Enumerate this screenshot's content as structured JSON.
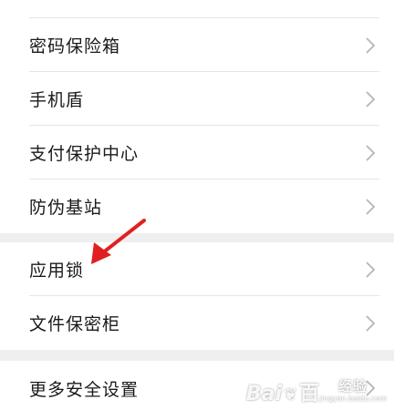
{
  "settings": {
    "items": [
      {
        "label": "密码保险箱"
      },
      {
        "label": "手机盾"
      },
      {
        "label": "支付保护中心"
      },
      {
        "label": "防伪基站"
      },
      {
        "label": "应用锁"
      },
      {
        "label": "文件保密柜"
      },
      {
        "label": "更多安全设置"
      }
    ]
  },
  "annotation": {
    "arrow_color": "#e02020"
  },
  "watermark": {
    "logo": "Bai",
    "logo_suffix": "百",
    "zh": "经验",
    "url": "jingyan.baidu.com"
  },
  "icons": {
    "row_chevron": "chevron-right-icon",
    "arrow": "red-arrow-icon"
  }
}
